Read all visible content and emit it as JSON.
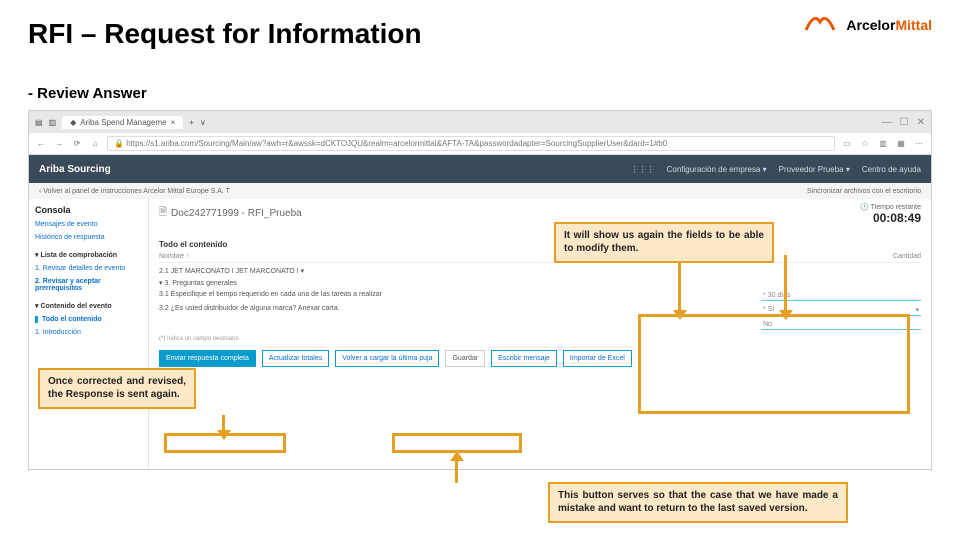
{
  "slide": {
    "title": "RFI – Request for Information",
    "subtitle": "- Review Answer"
  },
  "logo": {
    "part1": "Arcelor",
    "part2": "Mittal"
  },
  "browser": {
    "tab_title": "Ariba Spend Manageme",
    "url": "https://s1.ariba.com/Sourcing/Main/aw?awh=r&awssk=dCKTOJQU&realm=arcelormittal&AFTA-TA&passwordadapter=SourcingSupplierUser&dard=1#b0"
  },
  "ariba": {
    "brand": "Ariba Sourcing",
    "menu": {
      "config": "Configuración de empresa ▾",
      "user": "Proveedor Prueba ▾",
      "help": "Centro de ayuda"
    },
    "back": "‹ Volver al panel de instrucciones Arcelor Mittal Europe S.A. T",
    "sync": "Sincronizar archivos con el escritorio"
  },
  "side": {
    "console": "Consola",
    "links": {
      "events": "Mensajes de evento",
      "history": "Histórico de respuesta"
    },
    "checklist_h": "▾ Lista de comprobación",
    "step1": "1. Revisar detalles de evento",
    "step2": "2. Revisar y aceptar prerrequisitos",
    "content_h": "▾ Contenido del evento",
    "all": "Todo el contenido",
    "intro": "1. Introducción"
  },
  "main": {
    "doc": "Doc242771999 - RFI_Prueba",
    "time_lbl": "Tiempo restante",
    "time_val": "00:08:49",
    "section": "Todo el contenido",
    "col_name": "Nombre ↑",
    "col_qty": "Cantidad",
    "r1": "2.1   JET MARCONATO I   JET MARCONATO I ▾",
    "r2": "▾  3.  Preguntas generales",
    "q1": "3.1  Especifique el tiempo requerido en cada una de las tareas a realizar",
    "q1v": "30 días",
    "q2": "3.2  ¿Es usted distribuidor de alguna marca? Anexar carta.",
    "q2v": "Sí",
    "q3v": "No",
    "note": "(*) Indica un campo necesario",
    "buttons": {
      "submit": "Enviar respuesta completa",
      "update": "Actualizar totales",
      "reload": "Volver a cargar la última puja",
      "save": "Guardar",
      "msg": "Escribir mensaje",
      "import": "Importar de Excel"
    }
  },
  "callouts": {
    "top": "It will show us again the fields to be able to modify them.",
    "left": "Once corrected and revised, the Response is sent again.",
    "bottom": "This button serves so that the case that we have made a mistake and want to return to the last saved version."
  }
}
